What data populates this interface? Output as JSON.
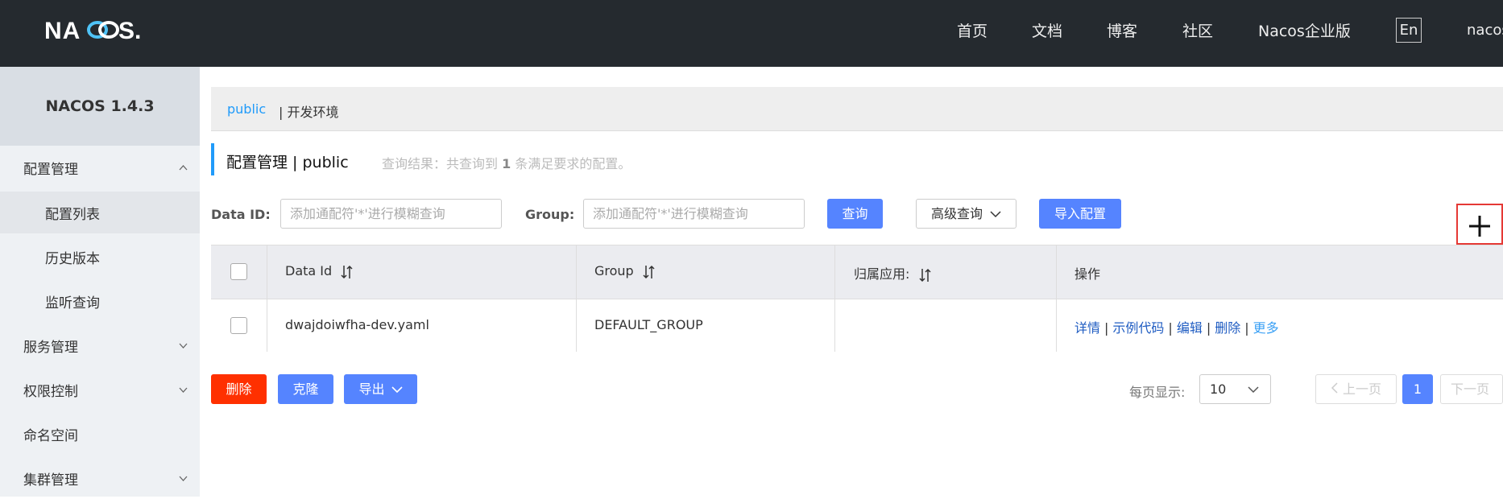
{
  "header": {
    "logo_text": "NACOS.",
    "nav": [
      "首页",
      "文档",
      "博客",
      "社区",
      "Nacos企业版"
    ],
    "lang_button": "En",
    "user": "nacos"
  },
  "sidebar": {
    "version": "NACOS 1.4.3",
    "items": [
      {
        "label": "配置管理",
        "level": 1,
        "chevron": "chevron-up-icon"
      },
      {
        "label": "配置列表",
        "level": 2,
        "active": true
      },
      {
        "label": "历史版本",
        "level": 2
      },
      {
        "label": "监听查询",
        "level": 2
      },
      {
        "label": "服务管理",
        "level": 1,
        "chevron": "chevron-down-icon"
      },
      {
        "label": "权限控制",
        "level": 1,
        "chevron": "chevron-down-icon"
      },
      {
        "label": "命名空间",
        "level": 1
      },
      {
        "label": "集群管理",
        "level": 1,
        "chevron": "chevron-down-icon"
      }
    ]
  },
  "namespace_bar": {
    "active": "public",
    "other": "| 开发环境"
  },
  "page_title": {
    "title": "配置管理  |  public",
    "result_prefix": "查询结果：共查询到",
    "result_count": "1",
    "result_suffix": "条满足要求的配置。"
  },
  "search": {
    "data_id_label": "Data ID:",
    "data_id_placeholder": "添加通配符'*'进行模糊查询",
    "group_label": "Group:",
    "group_placeholder": "添加通配符'*'进行模糊查询",
    "query_button": "查询",
    "advanced_button": "高级查询",
    "import_button": "导入配置"
  },
  "table": {
    "columns": [
      "Data Id",
      "Group",
      "归属应用:",
      "操作"
    ],
    "rows": [
      {
        "data_id": "dwajdoiwfha-dev.yaml",
        "group": "DEFAULT_GROUP",
        "app": "",
        "actions": [
          "详情",
          "示例代码",
          "编辑",
          "删除",
          "更多"
        ]
      }
    ]
  },
  "bulk": {
    "delete": "删除",
    "clone": "克隆",
    "export": "导出"
  },
  "pagination": {
    "per_page_label": "每页显示:",
    "per_page_value": "10",
    "prev": "上一页",
    "current": "1",
    "next": "下一页"
  },
  "colors": {
    "topbar": "#252a2f",
    "primary": "#5584ff",
    "danger": "#ff3000",
    "link": "#209bfa"
  }
}
